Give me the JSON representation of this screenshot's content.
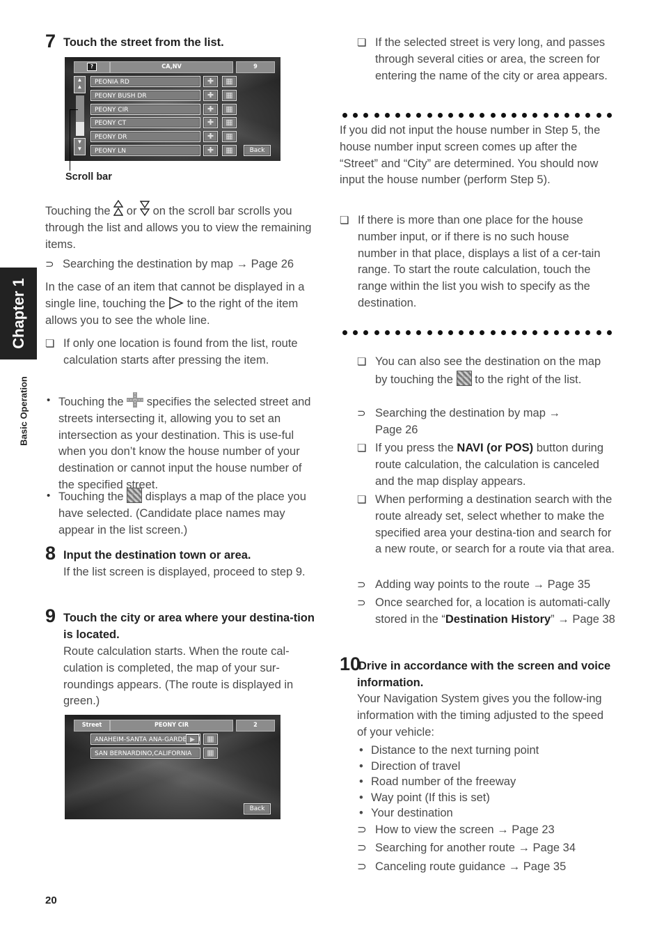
{
  "sidebar": {
    "chapter_tab": "Chapter 1",
    "section_label": "Basic Operation"
  },
  "page_number": "20",
  "step7": {
    "number": "7",
    "title": "Touch the street from the list.",
    "screen": {
      "header_icon": "question-flag-icon",
      "header_title": "CA,NV",
      "header_count": "9",
      "rows": [
        "PEONIA RD",
        "PEONY BUSH DR",
        "PEONY CIR",
        "PEONY CT",
        "PEONY DR",
        "PEONY LN"
      ],
      "back_label": "Back",
      "scroll_position": 0.3
    },
    "callout_label": "Scroll bar",
    "para1_a": "Touching the",
    "para1_b": "or",
    "para1_c": "on the scroll bar scrolls you through the list and allows you to view the remaining items.",
    "ref1": "Searching the destination by map → Page 26",
    "para2_a": "In the case of an item that cannot be displayed in a single line, touching the",
    "para2_b": "to the right of the item allows you to see the whole line.",
    "note1": "If only one location is found from the list, route calculation starts after pressing the item.",
    "bullet1_a": "Touching the",
    "bullet1_b": "specifies the selected street and streets intersecting it, allowing you to set an intersection as your destination. This is use-ful when you don’t know the house number of your destination or cannot input the house number of the specified street.",
    "bullet2_a": "Touching the",
    "bullet2_b": "displays a map of the place you have selected. (Candidate place names may appear in the list screen.)"
  },
  "step8": {
    "number": "8",
    "title": "Input the destination town or area.",
    "body": "If the list screen is displayed, proceed to step 9."
  },
  "step9": {
    "number": "9",
    "title": "Touch the city or area where your destina-tion is located.",
    "body": "Route calculation starts. When the route cal-culation is completed, the map of your sur-roundings appears. (The route is displayed in green.)",
    "screen": {
      "header_left": "Street",
      "header_title": "PEONY CIR",
      "header_count": "2",
      "rows": [
        "ANAHEIM-SANTA ANA-GARDEN GR",
        "SAN BERNARDINO,CALIFORNIA"
      ],
      "back_label": "Back"
    }
  },
  "right": {
    "note_top": "If the selected street is very long, and passes through several cities or area, the screen for entering the name of the city or area appears.",
    "block1_para": "If you did not input the house number in Step 5, the house number input screen comes up after the “Street” and “City” are determined. You should now input the house number (perform Step 5).",
    "block1_note": "If there is more than one place for the house number input, or if there is no such house number in that place, displays a list of a cer-tain range. To start the route calculation, touch the range within the list you wish to specify as the destination.",
    "note_map_a": "You can also see the destination on the map by touching the",
    "note_map_b": "to the right of the list.",
    "ref_map": "Searching the destination by map → Page 26",
    "note_navi_a": "If you press the",
    "note_navi_bold": "NAVI (or POS)",
    "note_navi_b": "button during route calculation, the calculation is canceled and the map display appears.",
    "note_search": "When performing a destination search with the route already set, select whether to make the specified area your destina-tion and search for a new route, or search for a route via that area.",
    "ref_waypoints": "Adding way points to the route → Page 35",
    "ref_history_a": "Once searched for, a location is automati-cally stored in the “",
    "ref_history_bold": "Destination History",
    "ref_history_b": "” → Page 38"
  },
  "step10": {
    "number": "10",
    "title": "Drive in accordance with the screen and voice information.",
    "body": "Your Navigation System gives you the follow-ing information with the timing adjusted to the speed of your vehicle:",
    "bullets": [
      "Distance to the next turning point",
      "Direction of travel",
      "Road number of the freeway",
      "Way point (If this is set)",
      "Your destination"
    ],
    "refs": [
      "How to view the screen → Page 23",
      "Searching for another route → Page 34",
      "Canceling route guidance → Page 35"
    ]
  },
  "markers": {
    "note": "❏",
    "ref": "⊃",
    "bullet": "•"
  }
}
